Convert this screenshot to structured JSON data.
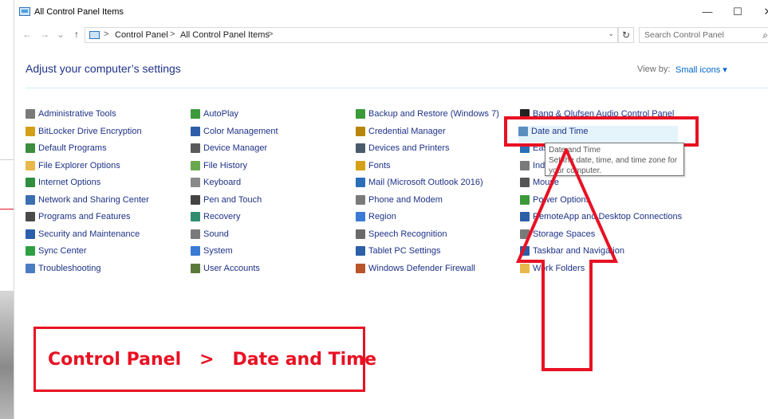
{
  "window": {
    "title": "All Control Panel Items",
    "controls": {
      "minimize": "—",
      "maximize": "☐",
      "close": "✕"
    }
  },
  "nav": {
    "back": "←",
    "forward": "→",
    "recent": "⌄",
    "up": "↑",
    "breadcrumbs": [
      "Control Panel",
      "All Control Panel Items"
    ],
    "separator": ">",
    "dropdown": "⌄",
    "refresh": "↻"
  },
  "search": {
    "placeholder": "Search Control Panel",
    "icon": "search-icon"
  },
  "header": {
    "title": "Adjust your computer’s settings",
    "view_by_label": "View by:",
    "view_by_value": "Small icons ▾"
  },
  "items": {
    "col1": [
      {
        "label": "Administrative Tools",
        "icon": "admin-tools-icon",
        "color": "#7a7a7a"
      },
      {
        "label": "BitLocker Drive Encryption",
        "icon": "bitlocker-icon",
        "color": "#d4a017"
      },
      {
        "label": "Default Programs",
        "icon": "default-programs-icon",
        "color": "#3c8d3c"
      },
      {
        "label": "File Explorer Options",
        "icon": "folder-options-icon",
        "color": "#e8b84a"
      },
      {
        "label": "Internet Options",
        "icon": "internet-options-icon",
        "color": "#2f8e3f"
      },
      {
        "label": "Network and Sharing Center",
        "icon": "network-icon",
        "color": "#3a6fb0"
      },
      {
        "label": "Programs and Features",
        "icon": "programs-icon",
        "color": "#4a4a4a"
      },
      {
        "label": "Security and Maintenance",
        "icon": "flag-icon",
        "color": "#2b5fad"
      },
      {
        "label": "Sync Center",
        "icon": "sync-icon",
        "color": "#2ea043"
      },
      {
        "label": "Troubleshooting",
        "icon": "troubleshooting-icon",
        "color": "#4a7cc2"
      }
    ],
    "col2": [
      {
        "label": "AutoPlay",
        "icon": "autoplay-icon",
        "color": "#3c9a3c"
      },
      {
        "label": "Color Management",
        "icon": "color-management-icon",
        "color": "#2d5fa8"
      },
      {
        "label": "Device Manager",
        "icon": "device-manager-icon",
        "color": "#5a5a5a"
      },
      {
        "label": "File History",
        "icon": "file-history-icon",
        "color": "#6aa84f"
      },
      {
        "label": "Keyboard",
        "icon": "keyboard-icon",
        "color": "#8a8a8a"
      },
      {
        "label": "Pen and Touch",
        "icon": "pen-icon",
        "color": "#444444"
      },
      {
        "label": "Recovery",
        "icon": "recovery-icon",
        "color": "#2f8e6f"
      },
      {
        "label": "Sound",
        "icon": "sound-icon",
        "color": "#7a7a7a"
      },
      {
        "label": "System",
        "icon": "system-icon",
        "color": "#3a7bd5"
      },
      {
        "label": "User Accounts",
        "icon": "user-accounts-icon",
        "color": "#5b7a3a"
      }
    ],
    "col3": [
      {
        "label": "Backup and Restore (Windows 7)",
        "icon": "backup-icon",
        "color": "#3a9a3a"
      },
      {
        "label": "Credential Manager",
        "icon": "credential-icon",
        "color": "#b8860b"
      },
      {
        "label": "Devices and Printers",
        "icon": "printer-icon",
        "color": "#4a5a6a"
      },
      {
        "label": "Fonts",
        "icon": "fonts-icon",
        "color": "#d4a017"
      },
      {
        "label": "Mail (Microsoft Outlook 2016)",
        "icon": "mail-icon",
        "color": "#2a6fb8"
      },
      {
        "label": "Phone and Modem",
        "icon": "phone-icon",
        "color": "#7a7a7a"
      },
      {
        "label": "Region",
        "icon": "region-icon",
        "color": "#3a7bd5"
      },
      {
        "label": "Speech Recognition",
        "icon": "microphone-icon",
        "color": "#6a6a6a"
      },
      {
        "label": "Tablet PC Settings",
        "icon": "tablet-icon",
        "color": "#2d5fa8"
      },
      {
        "label": "Windows Defender Firewall",
        "icon": "firewall-icon",
        "color": "#b8552a"
      }
    ],
    "col4": [
      {
        "label": "Bang & Olufsen Audio Control Panel",
        "icon": "audio-icon",
        "color": "#222222"
      },
      {
        "label": "Date and Time",
        "icon": "clock-icon",
        "color": "#5a8fc0",
        "highlighted": true
      },
      {
        "label": "Ease of Access Center",
        "icon": "ease-access-icon",
        "color": "#2a6fb8"
      },
      {
        "label": "Indexing Options",
        "icon": "indexing-icon",
        "color": "#7a7a7a"
      },
      {
        "label": "Mouse",
        "icon": "mouse-icon",
        "color": "#555555"
      },
      {
        "label": "Power Options",
        "icon": "power-icon",
        "color": "#3a9a3a"
      },
      {
        "label": "RemoteApp and Desktop Connections",
        "icon": "remote-icon",
        "color": "#2d5fa8"
      },
      {
        "label": "Storage Spaces",
        "icon": "storage-icon",
        "color": "#7a7a7a"
      },
      {
        "label": "Taskbar and Navigation",
        "icon": "taskbar-icon",
        "color": "#2d5fa8"
      },
      {
        "label": "Work Folders",
        "icon": "work-folders-icon",
        "color": "#e8b84a"
      }
    ]
  },
  "tooltip": {
    "title": "Date and Time",
    "body": "Set the date, time, and time zone for your computer."
  },
  "annotation": {
    "text": "Control Panel   >   Date and Time",
    "color": "#e81123"
  }
}
